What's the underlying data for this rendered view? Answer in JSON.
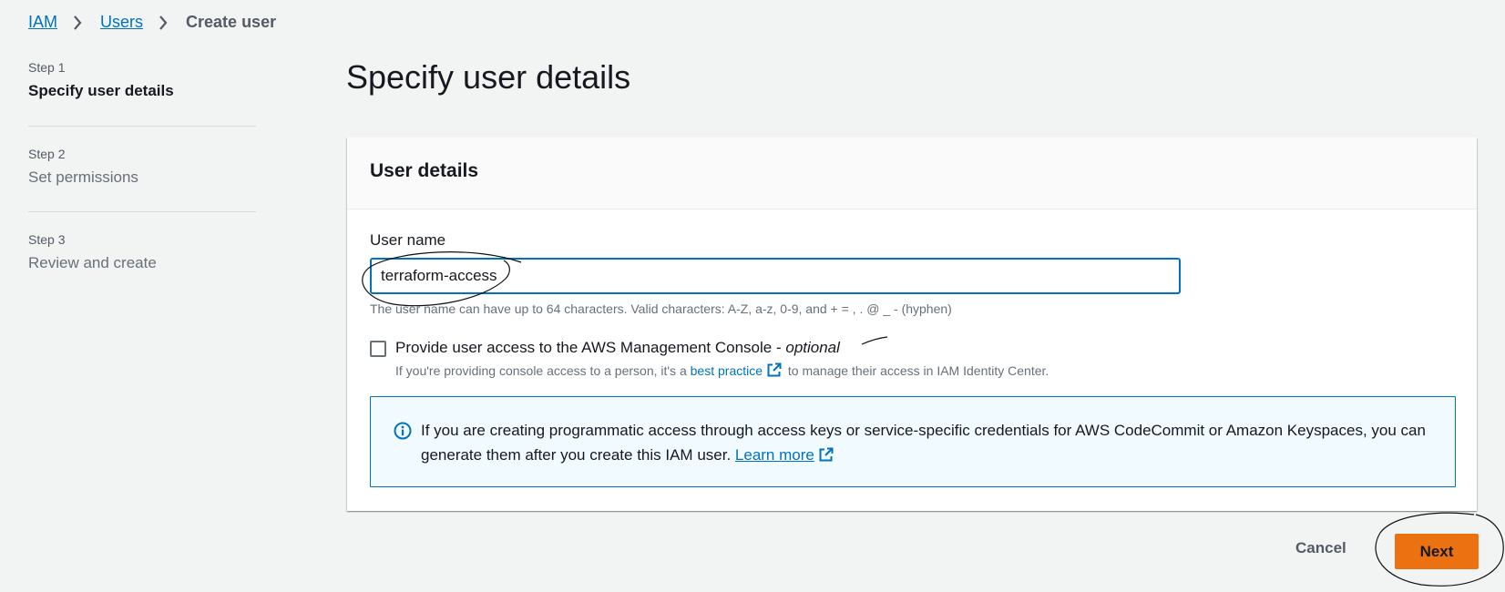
{
  "breadcrumb": {
    "items": [
      "IAM",
      "Users"
    ],
    "current": "Create user"
  },
  "steps": [
    {
      "number": "Step 1",
      "title": "Specify user details",
      "active": true
    },
    {
      "number": "Step 2",
      "title": "Set permissions",
      "active": false
    },
    {
      "number": "Step 3",
      "title": "Review and create",
      "active": false
    }
  ],
  "page": {
    "title": "Specify user details"
  },
  "panel": {
    "title": "User details",
    "username_label": "User name",
    "username_value": "terraform-access",
    "constraint": "The user name can have up to 64 characters. Valid characters: A-Z, a-z, 0-9, and + = , . @ _ - (hyphen)",
    "console_access_label": "Provide user access to the AWS Management Console - ",
    "console_access_optional": "optional",
    "console_access_checked": false,
    "desc_prefix": "If you're providing console access to a person, it's a ",
    "desc_link": "best practice",
    "desc_suffix": " to manage their access in IAM Identity Center."
  },
  "info": {
    "text": "If you are creating programmatic access through access keys or service-specific credentials for AWS CodeCommit or Amazon Keyspaces, you can generate them after you create this IAM user. ",
    "link": "Learn more"
  },
  "footer": {
    "cancel_label": "Cancel",
    "next_label": "Next"
  },
  "colors": {
    "primary_button": "#ec7211",
    "link": "#0073bb",
    "info_background": "#f1faff",
    "page_background": "#f2f3f3"
  }
}
